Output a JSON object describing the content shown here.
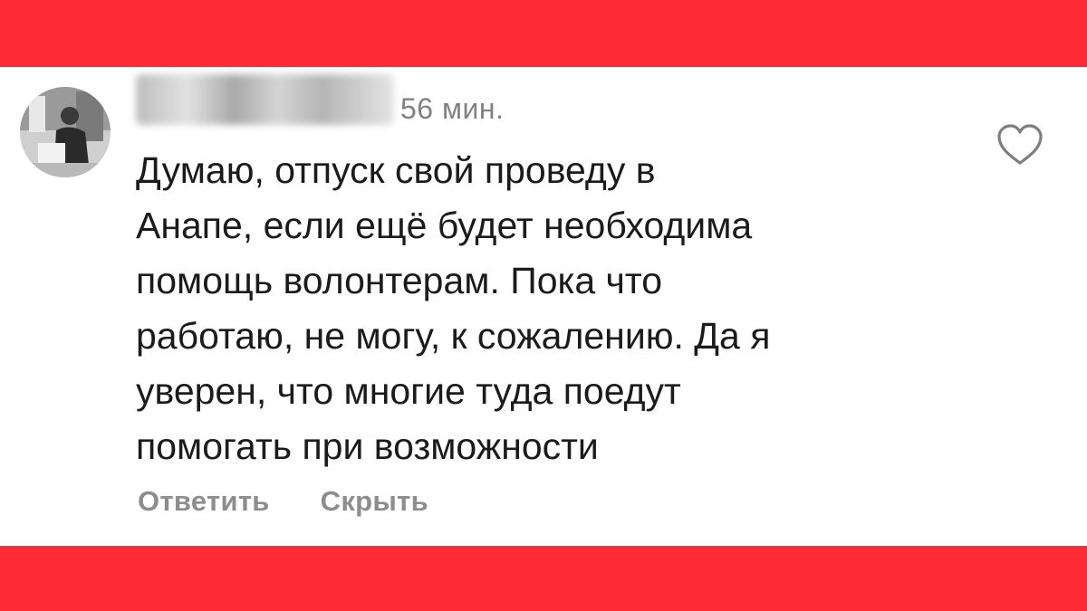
{
  "comment": {
    "author": "",
    "timestamp": "56 мин.",
    "text": "Думаю, отпуск свой проведу в\nАнапе, если ещё будет необходима\nпомощь волонтерам. Пока что\nработаю, не могу, к сожалению. Да я\nуверен, что многие туда поедут\nпомогать при возможности",
    "actions": {
      "reply_label": "Ответить",
      "hide_label": "Скрыть"
    },
    "like_icon": "heart-outline-icon"
  },
  "colors": {
    "band": "#fe2a37",
    "text": "#1b1b1b",
    "muted": "#818181"
  }
}
